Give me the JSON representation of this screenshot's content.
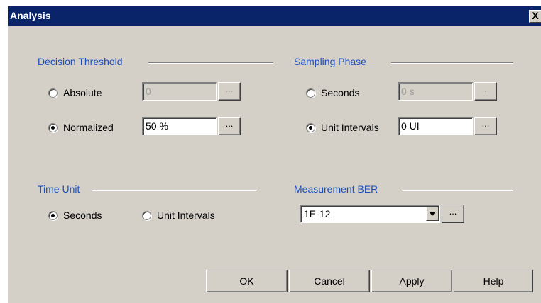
{
  "window": {
    "title": "Analysis",
    "close_glyph": "X"
  },
  "decision_threshold": {
    "heading": "Decision Threshold",
    "absolute_label": "Absolute",
    "absolute_value": "0",
    "normalized_label": "Normalized",
    "normalized_value": "50 %",
    "selected": "Normalized"
  },
  "sampling_phase": {
    "heading": "Sampling Phase",
    "seconds_label": "Seconds",
    "seconds_value": "0 s",
    "unit_intervals_label": "Unit Intervals",
    "unit_intervals_value": "0 UI",
    "selected": "Unit Intervals"
  },
  "time_unit": {
    "heading": "Time Unit",
    "seconds_label": "Seconds",
    "unit_intervals_label": "Unit Intervals",
    "selected": "Seconds"
  },
  "measurement_ber": {
    "heading": "Measurement BER",
    "value": "1E-12"
  },
  "browse_label": "...",
  "buttons": {
    "ok": "OK",
    "cancel": "Cancel",
    "apply": "Apply",
    "help": "Help"
  },
  "icons": {
    "close": "close-icon",
    "radio": "radio-button-icon",
    "dropdown": "chevron-down-icon"
  }
}
